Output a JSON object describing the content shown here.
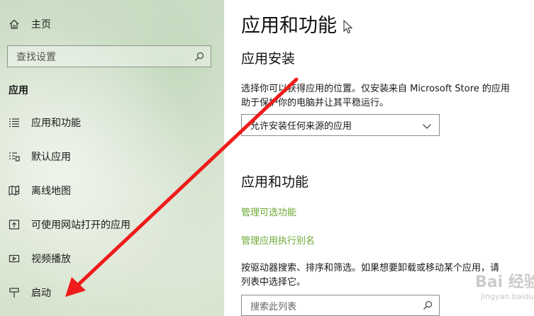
{
  "sidebar": {
    "home_label": "主页",
    "search_placeholder": "查找设置",
    "section_title": "应用",
    "items": [
      {
        "label": "应用和功能",
        "icon": "apps-list-icon"
      },
      {
        "label": "默认应用",
        "icon": "default-apps-icon"
      },
      {
        "label": "离线地图",
        "icon": "offline-maps-icon"
      },
      {
        "label": "可使用网站打开的应用",
        "icon": "apps-for-websites-icon"
      },
      {
        "label": "视频播放",
        "icon": "video-playback-icon"
      },
      {
        "label": "启动",
        "icon": "startup-icon"
      }
    ]
  },
  "main": {
    "title": "应用和功能",
    "install": {
      "heading": "应用安装",
      "description_line1": "选择你可以获得应用的位置。仅安装来自 Microsoft Store 的应用",
      "description_line2": "助于保护你的电脑并让其平稳运行。",
      "select_value": "允许安装任何来源的应用"
    },
    "features": {
      "heading": "应用和功能",
      "link_optional": "管理可选功能",
      "link_alias": "管理应用执行别名",
      "description_line1": "按驱动器搜索、排序和筛选。如果想要卸载或移动某个应用，请",
      "description_line2": "列表中选择它。",
      "search_placeholder": "搜索此列表"
    }
  },
  "watermark": {
    "text": "Bai 经验",
    "sub": "jingyan.baidu.com"
  },
  "colors": {
    "link": "#6aa832",
    "arrow": "#ee1c1c"
  }
}
